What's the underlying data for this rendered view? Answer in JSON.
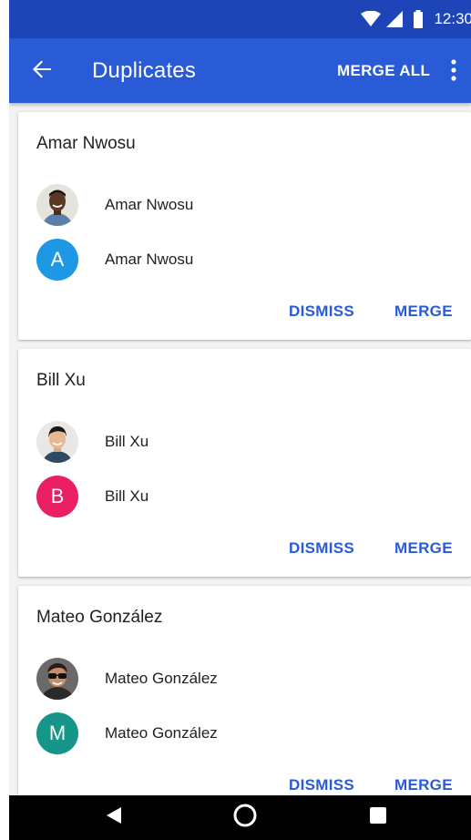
{
  "status_bar": {
    "time": "12:30",
    "wifi_icon": "wifi-icon",
    "signal_icon": "signal-icon",
    "battery_icon": "battery-icon"
  },
  "app_bar": {
    "title": "Duplicates",
    "merge_all_label": "MERGE ALL",
    "back_icon": "back-arrow-icon",
    "more_icon": "more-vert-icon",
    "color": "#2a5bd7",
    "status_color": "#1d45b8"
  },
  "cards": [
    {
      "title": "Amar Nwosu",
      "contacts": [
        {
          "name": "Amar Nwosu",
          "avatar_type": "photo"
        },
        {
          "name": "Amar Nwosu",
          "avatar_type": "letter",
          "letter": "A",
          "color": "#1e98e5"
        }
      ],
      "dismiss_label": "DISMISS",
      "merge_label": "MERGE"
    },
    {
      "title": "Bill Xu",
      "contacts": [
        {
          "name": "Bill Xu",
          "avatar_type": "photo"
        },
        {
          "name": "Bill Xu",
          "avatar_type": "letter",
          "letter": "B",
          "color": "#e91e63"
        }
      ],
      "dismiss_label": "DISMISS",
      "merge_label": "MERGE"
    },
    {
      "title": "Mateo González",
      "contacts": [
        {
          "name": "Mateo González",
          "avatar_type": "photo"
        },
        {
          "name": "Mateo González",
          "avatar_type": "letter",
          "letter": "M",
          "color": "#159688"
        }
      ],
      "dismiss_label": "DISMISS",
      "merge_label": "MERGE"
    }
  ],
  "nav_bar": {
    "back_icon": "nav-back-icon",
    "home_icon": "nav-home-icon",
    "recents_icon": "nav-recents-icon"
  }
}
